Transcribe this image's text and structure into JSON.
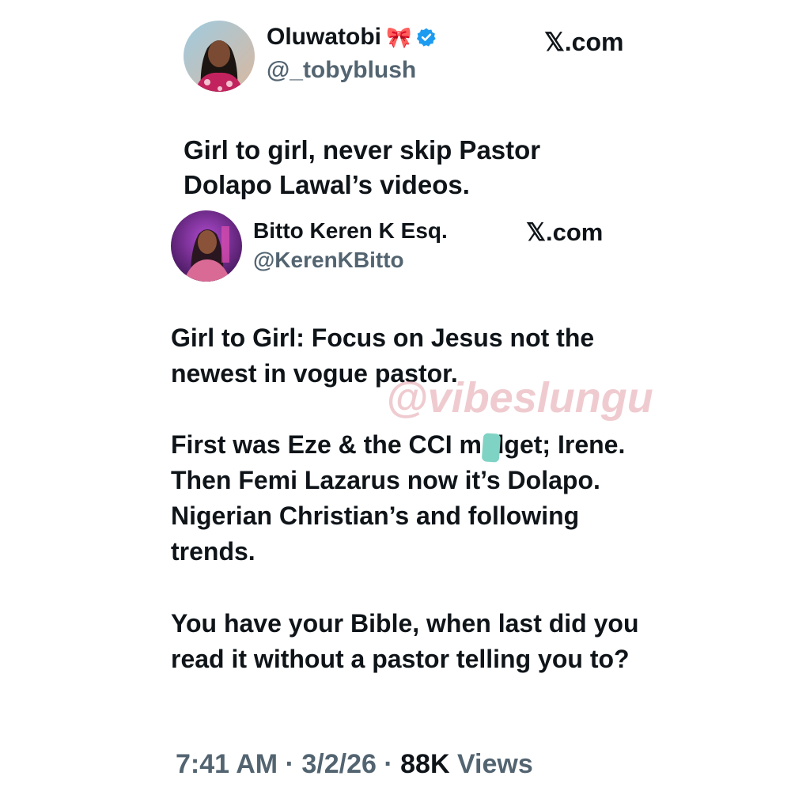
{
  "tweet1": {
    "name": "Oluwatobi",
    "name_emoji": "🎀",
    "handle": "@_tobyblush",
    "brand": "𝕏.com",
    "text": "Girl to girl, never skip Pastor Dolapo Lawal’s videos.",
    "verified": true
  },
  "tweet2": {
    "name": "Bitto Keren K Esq.",
    "handle": "@KerenKBitto",
    "brand": "𝕏.com",
    "paragraph1": "Girl to Girl: Focus on Jesus not the newest in vogue pastor.",
    "paragraph2": "First was Eze & the CCI m dget; Irene. Then Femi Lazarus now it’s Dolapo.  Nigerian Christian’s and following trends.",
    "paragraph3": "You have your Bible, when last did you read it without a pastor telling you to?",
    "time": "7:41 AM",
    "date": "3/2/26",
    "views_count": "88K",
    "views_label": "Views",
    "separator": "·"
  },
  "watermark": "@vibeslungu",
  "colors": {
    "text": "#0f1419",
    "secondary": "#536471",
    "verified_blue": "#1d9bf0",
    "watermark": "#e2a0aa",
    "redaction": "#7fd3c4"
  }
}
